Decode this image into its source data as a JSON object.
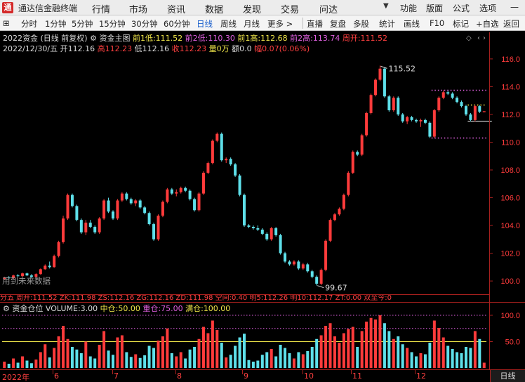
{
  "window": {
    "title": "通达信金融终端",
    "logo_char": "通"
  },
  "menu": [
    "行情",
    "市场",
    "资讯",
    "数据",
    "发现",
    "交易",
    "问达"
  ],
  "right_menu": [
    "功能",
    "版面",
    "公式",
    "选项"
  ],
  "window_controls": {
    "minimize": "—",
    "maximize": "□",
    "close": "✕"
  },
  "toolbar": {
    "periods": [
      "分时",
      "1分钟",
      "5分钟",
      "15分钟",
      "30分钟",
      "60分钟",
      "日线",
      "周线",
      "月线",
      "更多 >"
    ],
    "active_period": "日线",
    "tools": [
      "直播",
      "复盘",
      "多股",
      "统计",
      "画线",
      "F10",
      "标记",
      "+自选",
      "返回"
    ]
  },
  "info_line1": {
    "name": "2022资金 (日线 前复权)",
    "indicator": "资金主图",
    "low1_label": "前1低:",
    "low1": "111.52",
    "low2_label": "前2低:",
    "low2": "110.30",
    "high1_label": "前1高:",
    "high1": "112.68",
    "high2_label": "前2高:",
    "high2": "113.74",
    "week_open_label": "周开:",
    "week_open": "111.52"
  },
  "info_line2": {
    "date": "2022/12/30/五",
    "open_label": "开",
    "open": "112.16",
    "high_label": "高",
    "high": "112.23",
    "low_label": "低",
    "low": "112.16",
    "close_label": "收",
    "close": "112.23",
    "vol_label": "量",
    "vol": "0万",
    "amount_label": "额",
    "amount": "0.0",
    "change_label": "幅",
    "change": "0.07(0.06%)"
  },
  "future_note": "用到未来数据",
  "status_strip": "分五 周开:111.52 ZK:111.98 ZS:112.16 ZG:112.16 ZD:111.98 空间:0.40 明5:112.26 明10:112.17 ZT:0.00 双至今:0",
  "volume_header": {
    "name": "资金仓位",
    "volume_label": "VOLUME:",
    "volume": "3.00",
    "mid_label": "中仓:",
    "mid": "50.00",
    "heavy_label": "重仓:",
    "heavy": "75.00",
    "full_label": "满仓:",
    "full": "100.00"
  },
  "bottom": {
    "dates": [
      {
        "label": "2022年"
      },
      {
        "label": "6"
      },
      {
        "label": "7"
      },
      {
        "label": "8"
      },
      {
        "label": "9"
      },
      {
        "label": "10"
      },
      {
        "label": "11"
      },
      {
        "label": "12"
      }
    ],
    "period_button": "日线"
  },
  "colors": {
    "up": "#ff3b3b",
    "down": "#5ee0ea",
    "axis": "#a8201e",
    "yellow": "#f0e64a",
    "magenta": "#e060e0"
  },
  "chart_data": {
    "type": "candlestick",
    "price_axis": {
      "ticks": [
        100.0,
        102.0,
        104.0,
        106.0,
        108.0,
        110.0,
        112.0,
        114.0,
        116.0
      ],
      "ylim": [
        99.4,
        116.4
      ]
    },
    "volume_axis": {
      "ticks": [
        50.0,
        100.0
      ],
      "ylim": [
        0,
        112
      ]
    },
    "annotations": {
      "max": "115.52",
      "min": "99.67"
    },
    "support_resistance": {
      "upper": 113.74,
      "lower": 110.3,
      "short_upper": 112.68,
      "short_lower": 111.52
    },
    "reference_lines": {
      "mid": 50,
      "heavy": 75,
      "full": 100
    },
    "candles": [
      [
        100.15,
        100.3,
        100.1,
        100.25
      ],
      [
        100.25,
        100.35,
        100.15,
        100.2
      ],
      [
        100.2,
        100.45,
        100.15,
        100.4
      ],
      [
        100.4,
        100.5,
        100.3,
        100.35
      ],
      [
        100.35,
        100.6,
        100.3,
        100.55
      ],
      [
        100.55,
        100.6,
        100.35,
        100.4
      ],
      [
        100.4,
        100.5,
        100.2,
        100.3
      ],
      [
        100.3,
        100.55,
        100.25,
        100.5
      ],
      [
        100.5,
        100.9,
        100.45,
        100.85
      ],
      [
        100.85,
        101.2,
        100.8,
        101.1
      ],
      [
        101.1,
        101.4,
        100.9,
        101.0
      ],
      [
        101.0,
        101.9,
        100.95,
        101.8
      ],
      [
        101.8,
        102.9,
        101.7,
        102.8
      ],
      [
        102.8,
        104.7,
        102.7,
        104.5
      ],
      [
        104.5,
        106.3,
        104.4,
        106.2
      ],
      [
        106.2,
        106.3,
        105.3,
        105.4
      ],
      [
        105.4,
        105.5,
        104.3,
        104.4
      ],
      [
        104.4,
        104.5,
        103.4,
        103.5
      ],
      [
        103.5,
        104.4,
        103.3,
        104.2
      ],
      [
        104.2,
        104.4,
        103.8,
        103.9
      ],
      [
        103.9,
        104.0,
        103.4,
        103.5
      ],
      [
        103.5,
        104.6,
        103.4,
        104.5
      ],
      [
        104.5,
        105.9,
        104.4,
        105.8
      ],
      [
        105.8,
        106.0,
        104.9,
        105.0
      ],
      [
        105.0,
        105.1,
        104.4,
        104.5
      ],
      [
        104.5,
        105.9,
        104.4,
        105.8
      ],
      [
        105.8,
        106.4,
        105.7,
        106.3
      ],
      [
        106.3,
        106.4,
        105.8,
        105.9
      ],
      [
        105.9,
        106.0,
        105.5,
        105.6
      ],
      [
        105.6,
        105.9,
        105.4,
        105.8
      ],
      [
        105.8,
        105.9,
        105.2,
        105.3
      ],
      [
        105.3,
        105.4,
        104.8,
        104.9
      ],
      [
        104.9,
        105.0,
        104.0,
        104.1
      ],
      [
        104.1,
        104.2,
        102.9,
        103.0
      ],
      [
        103.0,
        104.8,
        102.9,
        104.7
      ],
      [
        104.7,
        105.8,
        104.6,
        105.7
      ],
      [
        105.7,
        106.7,
        105.6,
        106.6
      ],
      [
        106.6,
        106.7,
        106.2,
        106.3
      ],
      [
        106.3,
        106.6,
        106.1,
        106.4
      ],
      [
        106.4,
        106.8,
        106.3,
        106.7
      ],
      [
        106.7,
        106.8,
        106.4,
        106.5
      ],
      [
        106.5,
        106.6,
        105.8,
        105.9
      ],
      [
        105.9,
        106.0,
        105.0,
        105.1
      ],
      [
        105.1,
        106.4,
        105.0,
        106.3
      ],
      [
        106.3,
        107.9,
        106.2,
        107.8
      ],
      [
        107.8,
        108.6,
        107.7,
        108.5
      ],
      [
        108.5,
        110.2,
        108.4,
        110.1
      ],
      [
        110.1,
        110.7,
        110.0,
        110.6
      ],
      [
        110.6,
        110.7,
        108.6,
        108.7
      ],
      [
        108.7,
        108.9,
        108.5,
        108.8
      ],
      [
        108.8,
        108.9,
        108.3,
        108.4
      ],
      [
        108.4,
        108.5,
        107.5,
        107.6
      ],
      [
        107.6,
        107.7,
        106.1,
        106.2
      ],
      [
        106.2,
        106.3,
        103.9,
        104.0
      ],
      [
        104.0,
        104.1,
        103.8,
        103.9
      ],
      [
        103.9,
        104.0,
        103.7,
        103.8
      ],
      [
        103.8,
        104.0,
        103.6,
        103.7
      ],
      [
        103.7,
        103.8,
        103.3,
        103.4
      ],
      [
        103.4,
        103.5,
        102.9,
        103.0
      ],
      [
        103.0,
        103.9,
        102.9,
        103.8
      ],
      [
        103.8,
        103.9,
        103.2,
        103.3
      ],
      [
        103.3,
        103.4,
        101.9,
        102.0
      ],
      [
        102.0,
        102.1,
        101.3,
        101.4
      ],
      [
        101.4,
        101.5,
        101.1,
        101.2
      ],
      [
        101.2,
        101.5,
        101.1,
        101.4
      ],
      [
        101.4,
        101.5,
        100.8,
        100.9
      ],
      [
        100.9,
        101.3,
        100.8,
        101.2
      ],
      [
        101.2,
        101.3,
        100.6,
        100.7
      ],
      [
        100.7,
        100.8,
        100.2,
        100.3
      ],
      [
        100.3,
        100.4,
        99.67,
        99.8
      ],
      [
        99.8,
        100.9,
        99.7,
        100.8
      ],
      [
        100.8,
        103.0,
        100.7,
        102.9
      ],
      [
        102.9,
        104.5,
        102.8,
        104.4
      ],
      [
        104.4,
        104.9,
        104.3,
        104.8
      ],
      [
        104.8,
        105.3,
        104.7,
        105.2
      ],
      [
        105.2,
        106.3,
        105.1,
        106.2
      ],
      [
        106.2,
        107.9,
        106.1,
        107.8
      ],
      [
        107.8,
        109.4,
        107.7,
        109.3
      ],
      [
        109.3,
        109.4,
        109.0,
        109.1
      ],
      [
        109.1,
        110.6,
        109.0,
        110.5
      ],
      [
        110.5,
        112.2,
        110.4,
        112.1
      ],
      [
        112.1,
        113.5,
        112.0,
        113.4
      ],
      [
        113.4,
        114.6,
        113.3,
        114.5
      ],
      [
        114.5,
        115.52,
        114.4,
        115.3
      ],
      [
        115.3,
        115.4,
        113.2,
        113.3
      ],
      [
        113.3,
        113.4,
        112.2,
        112.3
      ],
      [
        112.3,
        113.3,
        112.2,
        113.2
      ],
      [
        113.2,
        113.3,
        111.9,
        112.0
      ],
      [
        112.0,
        112.1,
        111.4,
        111.5
      ],
      [
        111.5,
        111.9,
        111.3,
        111.8
      ],
      [
        111.8,
        111.9,
        111.5,
        111.6
      ],
      [
        111.6,
        111.7,
        111.4,
        111.5
      ],
      [
        111.5,
        111.7,
        111.1,
        111.6
      ],
      [
        111.6,
        111.7,
        111.3,
        111.4
      ],
      [
        111.4,
        111.5,
        110.3,
        110.4
      ],
      [
        110.4,
        112.4,
        110.3,
        112.3
      ],
      [
        112.3,
        113.3,
        112.2,
        113.2
      ],
      [
        113.2,
        113.74,
        113.1,
        113.6
      ],
      [
        113.6,
        113.7,
        113.4,
        113.5
      ],
      [
        113.5,
        113.6,
        113.1,
        113.2
      ],
      [
        113.2,
        113.3,
        112.8,
        112.9
      ],
      [
        112.9,
        113.0,
        112.5,
        112.6
      ],
      [
        112.6,
        112.7,
        111.9,
        112.0
      ],
      [
        112.0,
        112.1,
        111.5,
        111.6
      ],
      [
        111.6,
        112.68,
        111.5,
        112.6
      ],
      [
        112.6,
        112.68,
        112.1,
        112.2
      ],
      [
        112.16,
        112.23,
        112.16,
        112.23
      ]
    ],
    "volume_values": [
      12,
      8,
      18,
      10,
      22,
      14,
      9,
      16,
      30,
      45,
      20,
      38,
      60,
      80,
      55,
      40,
      35,
      28,
      50,
      22,
      18,
      44,
      70,
      33,
      25,
      58,
      62,
      30,
      21,
      26,
      19,
      24,
      42,
      38,
      52,
      60,
      75,
      28,
      22,
      30,
      18,
      35,
      40,
      55,
      78,
      66,
      90,
      72,
      48,
      20,
      25,
      42,
      58,
      65,
      15,
      12,
      14,
      25,
      30,
      36,
      22,
      44,
      38,
      28,
      18,
      30,
      26,
      32,
      40,
      55,
      62,
      80,
      85,
      60,
      48,
      66,
      74,
      78,
      40,
      70,
      88,
      95,
      92,
      100,
      85,
      70,
      55,
      60,
      45,
      38,
      30,
      22,
      28,
      26,
      48,
      90,
      76,
      58,
      42,
      36,
      30,
      28,
      40,
      38,
      70,
      55,
      10
    ]
  }
}
